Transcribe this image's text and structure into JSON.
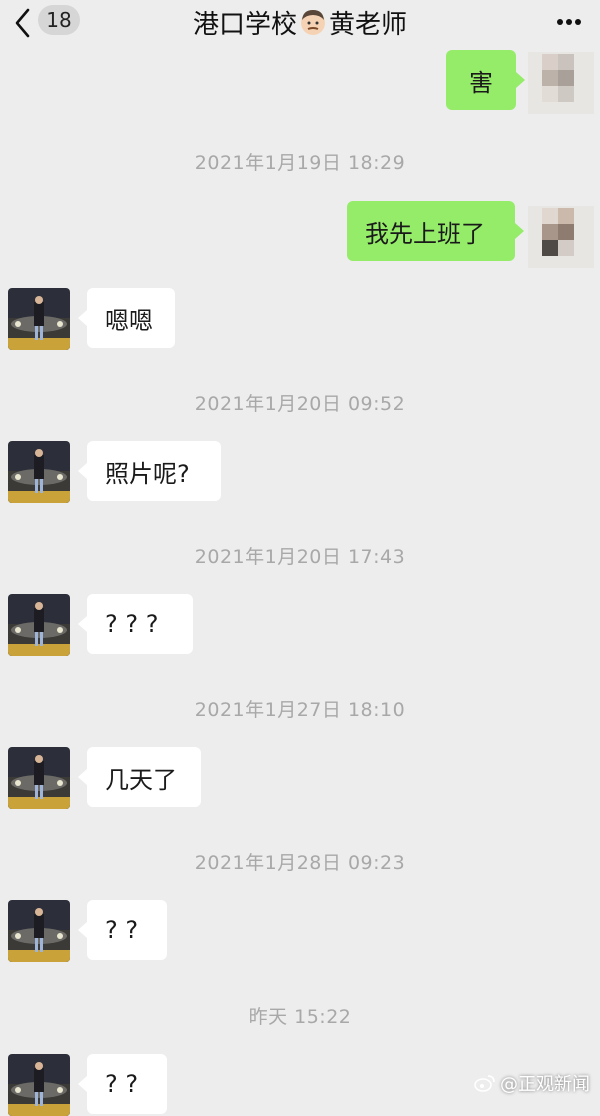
{
  "header": {
    "back_badge": "18",
    "title_prefix": "港口学校",
    "title_suffix": "黄老师",
    "title_emoji": "man-face-emoji"
  },
  "messages": [
    {
      "side": "out",
      "text": "害"
    },
    {
      "side": "time",
      "text": "2021年1月19日 18:29"
    },
    {
      "side": "out",
      "text": "我先上班了"
    },
    {
      "side": "in",
      "text": "嗯嗯"
    },
    {
      "side": "time",
      "text": "2021年1月20日 09:52"
    },
    {
      "side": "in",
      "text": "照片呢?"
    },
    {
      "side": "time",
      "text": "2021年1月20日 17:43"
    },
    {
      "side": "in",
      "text": "? ? ?"
    },
    {
      "side": "time",
      "text": "2021年1月27日 18:10"
    },
    {
      "side": "in",
      "text": "几天了"
    },
    {
      "side": "time",
      "text": "2021年1月28日 09:23"
    },
    {
      "side": "in",
      "text": "? ?"
    },
    {
      "side": "time",
      "text": "昨天 15:22"
    },
    {
      "side": "in",
      "text": "? ?"
    }
  ],
  "watermark": "@正观新闻",
  "colors": {
    "background": "#ededed",
    "outgoing_bubble": "#95ec69",
    "incoming_bubble": "#ffffff",
    "timestamp": "#a8a8a8"
  }
}
